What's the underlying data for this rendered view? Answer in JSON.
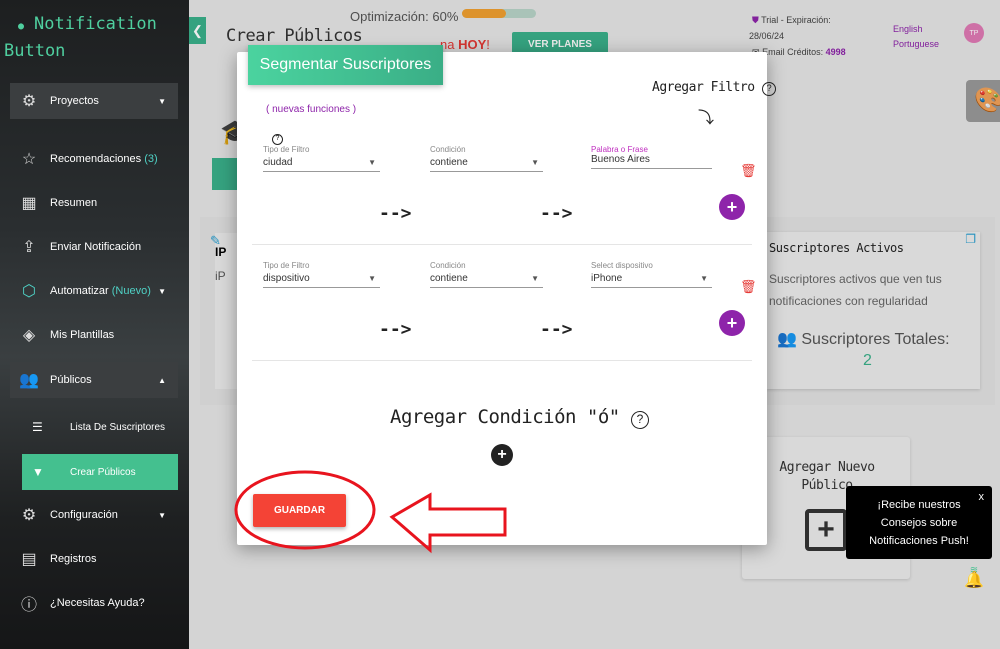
{
  "brand": {
    "line1": "Notification",
    "line2": "Button"
  },
  "sidebar": {
    "items": [
      {
        "label": "Proyectos",
        "icon": "project-icon"
      },
      {
        "label": "Recomendaciones",
        "badge": "(3)",
        "icon": "star-icon"
      },
      {
        "label": "Resumen",
        "icon": "grid-icon"
      },
      {
        "label": "Enviar Notificación",
        "icon": "share-icon"
      },
      {
        "label": "Automatizar",
        "badge": "(Nuevo)",
        "icon": "automation-icon"
      },
      {
        "label": "Mis Plantillas",
        "icon": "layers-icon"
      },
      {
        "label": "Públicos",
        "icon": "users-icon"
      },
      {
        "label": "Lista De Suscriptores",
        "icon": "list-icon"
      },
      {
        "label": "Crear Públicos",
        "icon": "filter-icon"
      },
      {
        "label": "Configuración",
        "icon": "gear-icon"
      },
      {
        "label": "Registros",
        "icon": "server-icon"
      },
      {
        "label": "¿Necesitas Ayuda?",
        "icon": "help-icon"
      }
    ]
  },
  "header": {
    "page_title": "Crear Públicos",
    "optimization_label": "Optimización: 60%",
    "optimization_percent": 60,
    "promo_end": "na",
    "promo_hoy": "HOY",
    "promo_bang": "!",
    "plans_button": "VER PLANES",
    "trial": "Trial - Expiración:",
    "trial_date": "28/06/24",
    "email_credits_label": "Email Créditos:",
    "email_credits": "4998",
    "lang_en": "English",
    "lang_pt": "Portuguese",
    "avatar": "TP"
  },
  "background": {
    "card_title_partial": "IP",
    "card_text_partial": "iP",
    "active_title": "Suscriptores Activos",
    "active_desc": "Suscriptores activos que ven tus notificaciones con regularidad",
    "total_label": "Suscriptores Totales:",
    "total_value": "2",
    "add_public": "Agregar Nuevo Público"
  },
  "modal": {
    "title": "Segmentar Suscriptores",
    "add_filter": "Agregar Filtro",
    "new_features": "( nuevas funciones )",
    "arrow": "-->",
    "filters": [
      {
        "type_label": "Tipo de Filtro",
        "type": "ciudad",
        "cond_label": "Condición",
        "cond": "contiene",
        "value_label": "Palabra o Frase",
        "value": "Buenos Aires"
      },
      {
        "type_label": "Tipo de Filtro",
        "type": "dispositivo",
        "cond_label": "Condición",
        "cond": "contiene",
        "value_label": "Select dispositivo",
        "value": "iPhone"
      }
    ],
    "add_or": "Agregar Condición \"ó\"",
    "save": "GUARDAR"
  },
  "tooltip": {
    "text1": "¡Recibe nuestros",
    "text2": "Consejos sobre",
    "text3": "Notificaciones Push!",
    "close": "x"
  },
  "colors": {
    "accent": "#44c08f",
    "purple": "#8e24aa",
    "danger": "#f44336",
    "orange": "#f0a030"
  }
}
